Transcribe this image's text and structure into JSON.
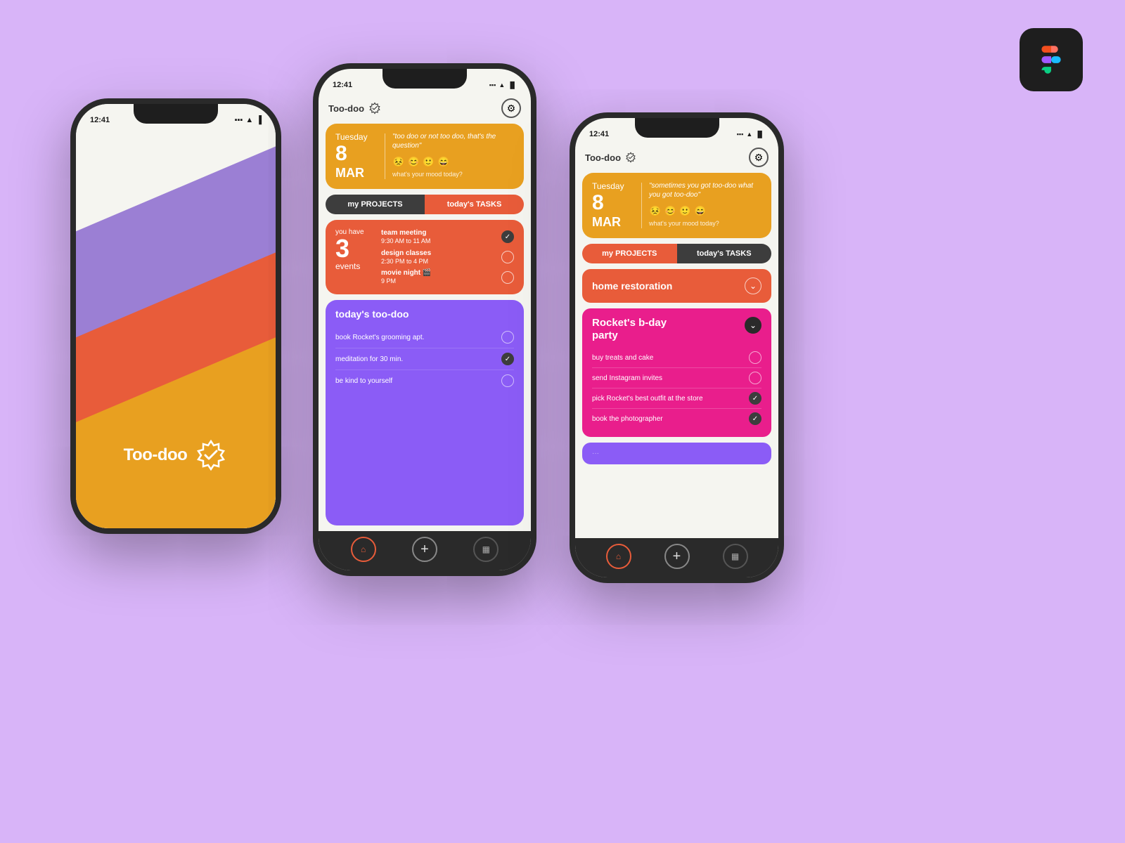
{
  "app": {
    "name": "Too-doo",
    "logo_label": "Too-doo ✓"
  },
  "figma": {
    "label": "Figma"
  },
  "phone1": {
    "splash_title": "Too-doo",
    "status_time": "12:41"
  },
  "phone2": {
    "status_time": "12:41",
    "app_name": "Too-doo",
    "date": {
      "day_name": "Tuesday",
      "day_num": "8",
      "month": "MAR",
      "quote": "\"too doo or not too doo, that's the question\"",
      "mood_label": "what's your mood today?"
    },
    "tabs": {
      "projects": "my PROJECTS",
      "tasks": "today's TASKS"
    },
    "events": {
      "label": "you have",
      "count": "3",
      "unit": "events",
      "items": [
        {
          "name": "team meeting",
          "time": "9:30 AM to 11 AM",
          "checked": true
        },
        {
          "name": "design classes",
          "time": "2:30 PM to 4 PM",
          "checked": false
        },
        {
          "name": "movie night 🎬",
          "time": "9 PM",
          "checked": false
        }
      ]
    },
    "toodoo": {
      "title": "today's too-doo",
      "items": [
        {
          "text": "book Rocket's grooming apt.",
          "checked": false
        },
        {
          "text": "meditation for 30 min.",
          "checked": true
        },
        {
          "text": "be kind to yourself",
          "checked": false
        }
      ]
    },
    "nav": {
      "home": "🏠",
      "add": "+",
      "calendar": "📅"
    }
  },
  "phone3": {
    "status_time": "12:41",
    "app_name": "Too-doo",
    "date": {
      "day_name": "Tuesday",
      "day_num": "8",
      "month": "MAR",
      "quote": "\"sometimes you got too-doo what you got too-doo\"",
      "mood_label": "what's your mood today?"
    },
    "tabs": {
      "projects": "my PROJECTS",
      "tasks": "today's TASKS"
    },
    "projects": [
      {
        "name": "home restoration",
        "color": "orange",
        "expanded": false
      }
    ],
    "party_project": {
      "name": "Rocket's b-day\nparty",
      "color": "pink",
      "expanded": true,
      "subtasks": [
        {
          "text": "buy treats and cake",
          "checked": false
        },
        {
          "text": "send Instagram invites",
          "checked": false
        },
        {
          "text": "pick Rocket's best outfit at the store",
          "checked": true
        },
        {
          "text": "book the photographer",
          "checked": true
        }
      ]
    },
    "nav": {
      "home": "🏠",
      "add": "+",
      "calendar": "📅"
    }
  }
}
